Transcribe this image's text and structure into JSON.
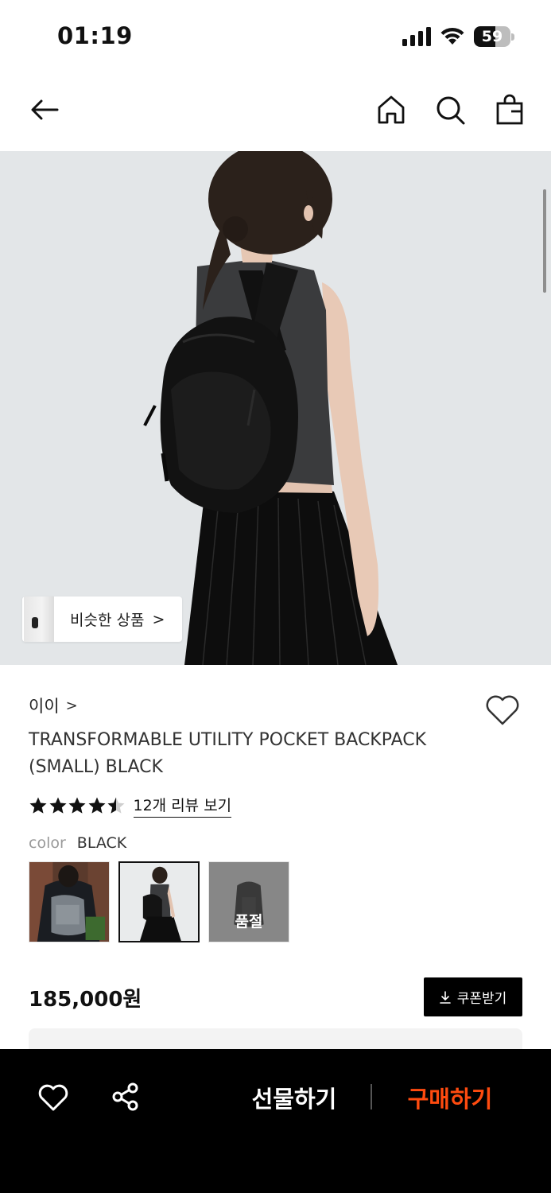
{
  "status_bar": {
    "time": "01:19",
    "battery_level": "59",
    "battery_fraction": 0.59,
    "signal_icon": "cellular-signal-icon",
    "wifi_icon": "wifi-icon"
  },
  "nav": {
    "back_icon": "back-arrow-icon",
    "home_icon": "home-icon",
    "search_icon": "search-icon",
    "bag_icon": "shopping-bag-icon"
  },
  "hero": {
    "similar_label": "비슷한 상품",
    "similar_chevron": ">"
  },
  "product": {
    "brand": "이이",
    "brand_chevron": ">",
    "title": "TRANSFORMABLE UTILITY POCKET BACKPACK (SMALL) BLACK",
    "rating": 4.5,
    "review_link": "12개 리뷰 보기",
    "color_label": "color",
    "color_value": "BLACK",
    "swatches": [
      {
        "name": "grey-backpack-variant"
      },
      {
        "name": "black-backpack-variant",
        "selected": true
      },
      {
        "name": "soldout-variant",
        "label": "품절"
      }
    ],
    "price": "185,000원",
    "coupon_label": "쿠폰받기"
  },
  "bottom_bar": {
    "gift_label": "선물하기",
    "buy_label": "구매하기"
  },
  "colors": {
    "accent_orange": "#ff4b0f",
    "black": "#000000",
    "hero_bg": "#e3e6e8"
  }
}
